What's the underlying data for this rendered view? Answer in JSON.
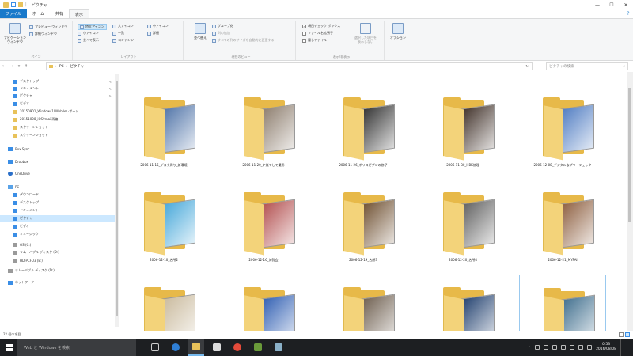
{
  "titlebar": {
    "path_glyph": "|",
    "title": "ピクチャ",
    "minimize": "—",
    "maximize": "☐",
    "close": "✕"
  },
  "tabs": [
    {
      "label": "ファイル"
    },
    {
      "label": "ホーム"
    },
    {
      "label": "共有"
    },
    {
      "label": "表示"
    }
  ],
  "help_glyph": "?",
  "ribbon": {
    "pane_group": {
      "label": "ペイン",
      "nav_pane": "ナビゲーション\nウィンドウ",
      "preview": "プレビュー ウィンドウ",
      "details": "詳細ウィンドウ"
    },
    "layout_group": {
      "label": "レイアウト",
      "items": [
        "特大アイコン",
        "大アイコン",
        "中アイコン",
        "小アイコン",
        "一覧",
        "詳細",
        "並べて表示",
        "コンテンツ"
      ]
    },
    "current_view_group": {
      "label": "現在のビュー",
      "sort": "並べ替え",
      "group_by": "グループ化",
      "add_columns": "列の追加",
      "fit_columns": "すべての列のサイズを自動的に変更する"
    },
    "show_hide_group": {
      "label": "表示/非表示",
      "item_checkboxes": "項目チェック ボックス",
      "file_extensions": "ファイル名拡張子",
      "hidden_items": "隠しファイル",
      "hide_selected": "選択した項目を\n表示しない",
      "options": "オプション"
    }
  },
  "address": {
    "back": "←",
    "forward": "→",
    "up": "↑",
    "crumbs": [
      "PC",
      "ピクチャ"
    ],
    "search_placeholder": "ピクチャの検索"
  },
  "nav": {
    "items": [
      {
        "label": "デスクトップ",
        "icon": "desktop-icon",
        "pinned": true
      },
      {
        "label": "ドキュメント",
        "icon": "documents-icon",
        "pinned": true
      },
      {
        "label": "ピクチャ",
        "icon": "pictures-icon",
        "pinned": true
      },
      {
        "label": "ビデオ",
        "icon": "videos-icon",
        "pinned": false
      },
      {
        "label": "20150901_Windows10Mobileレポート",
        "icon": "folder-icon",
        "pinned": false
      },
      {
        "label": "20151008_iOS9mail再編",
        "icon": "folder-icon",
        "pinned": false
      },
      {
        "label": "スクリーンショット",
        "icon": "folder-icon",
        "pinned": false
      },
      {
        "label": "スクリーンショット",
        "icon": "folder-icon",
        "pinned": false
      },
      {
        "label": "Box Sync",
        "icon": "box-icon",
        "pinned": false
      },
      {
        "label": "Dropbox",
        "icon": "dropbox-icon",
        "pinned": false
      },
      {
        "label": "OneDrive",
        "icon": "onedrive-icon",
        "pinned": false
      },
      {
        "label": "PC",
        "icon": "pc-icon",
        "pinned": false
      },
      {
        "label": "ダウンロード",
        "icon": "downloads-icon",
        "pinned": false
      },
      {
        "label": "デスクトップ",
        "icon": "desktop-icon",
        "pinned": false
      },
      {
        "label": "ドキュメント",
        "icon": "documents-icon",
        "pinned": false
      },
      {
        "label": "ピクチャ",
        "icon": "pictures-icon",
        "pinned": false
      },
      {
        "label": "ビデオ",
        "icon": "videos-icon",
        "pinned": false
      },
      {
        "label": "ミュージック",
        "icon": "music-icon",
        "pinned": false
      },
      {
        "label": "OS (C:)",
        "icon": "drive-icon",
        "pinned": false
      },
      {
        "label": "リムーバブル ディスク (D:)",
        "icon": "drive-icon",
        "pinned": false
      },
      {
        "label": "HD-PCFU3 (E:)",
        "icon": "drive-icon",
        "pinned": false
      },
      {
        "label": "リムーバブル ディスク (D:)",
        "icon": "drive-icon",
        "pinned": false
      },
      {
        "label": "ネットワーク",
        "icon": "network-icon",
        "pinned": false
      }
    ]
  },
  "folders": [
    {
      "name": "2006-11-15_デスク周り_新環境",
      "photo_color": "#4a6fa5"
    },
    {
      "name": "2006-11-20_ケ嵐でして撮影",
      "photo_color": "#8a7a6a"
    },
    {
      "name": "2006-11-26_ポリスピプンの修了",
      "photo_color": "#2a2a2a"
    },
    {
      "name": "2006-11-30_HBK修理",
      "photo_color": "#3a2a22"
    },
    {
      "name": "2006-12-08_デジタルなプリーツェック",
      "photo_color": "#4a78c0"
    },
    {
      "name": "2006-12-10_名所2",
      "photo_color": "#3fa4d8"
    },
    {
      "name": "2006-12-16_博覧会",
      "photo_color": "#b04a4a"
    },
    {
      "name": "2006-12-19_名所3",
      "photo_color": "#6a4a2a"
    },
    {
      "name": "2006-12-20_名所4",
      "photo_color": "#5a5a5a"
    },
    {
      "name": "2006-12-21_MYPAI",
      "photo_color": "#8a5a3a"
    },
    {
      "name": "",
      "photo_color": "#c8b89a"
    },
    {
      "name": "",
      "photo_color": "#2a5ab0"
    },
    {
      "name": "",
      "photo_color": "#6a5a4a"
    },
    {
      "name": "",
      "photo_color": "#1a3a6a"
    },
    {
      "name": "",
      "photo_color": "#3a6a8a"
    }
  ],
  "status": {
    "item_count": "22 個の項目"
  },
  "taskbar": {
    "search_placeholder": "Web と Windows を検索",
    "clock_time": "0:53",
    "clock_date": "2016/08/08"
  }
}
